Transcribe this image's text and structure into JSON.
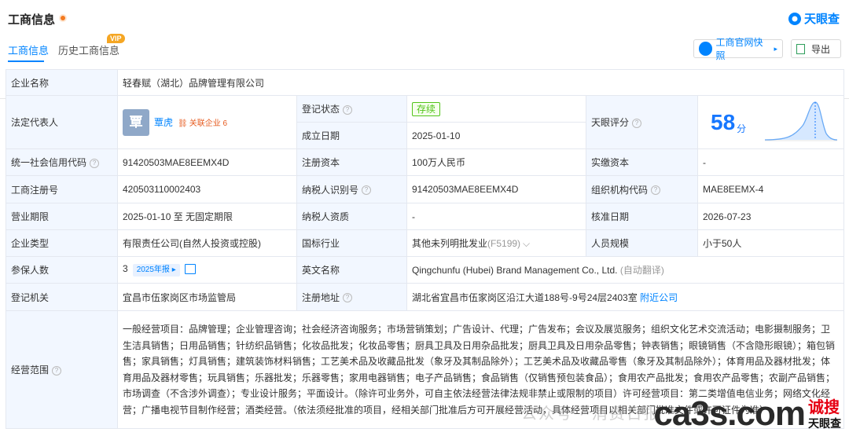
{
  "header": {
    "title": "工商信息",
    "logo_text": "天眼查"
  },
  "tabs": [
    {
      "label": "工商信息"
    },
    {
      "label": "历史工商信息"
    }
  ],
  "vip_label": "VIP",
  "buttons": {
    "snapshot": "工商官网快照",
    "export": "导出"
  },
  "fields": {
    "company_name_k": "企业名称",
    "company_name_v": "轻春赋（湖北）品牌管理有限公司",
    "legal_rep_k": "法定代表人",
    "legal_rep_avatar": "覃",
    "legal_rep_name": "覃虎",
    "legal_rep_related": "关联企业 6",
    "reg_status_k": "登记状态",
    "reg_status_v": "存续",
    "founded_k": "成立日期",
    "founded_v": "2025-01-10",
    "score_k": "天眼评分",
    "score_v": "58",
    "score_unit": "分",
    "credit_code_k": "统一社会信用代码",
    "credit_code_v": "91420503MAE8EEMX4D",
    "reg_capital_k": "注册资本",
    "reg_capital_v": "100万人民币",
    "paid_capital_k": "实缴资本",
    "paid_capital_v": "-",
    "reg_no_k": "工商注册号",
    "reg_no_v": "420503110002403",
    "taxpayer_id_k": "纳税人识别号",
    "taxpayer_id_v": "91420503MAE8EEMX4D",
    "org_code_k": "组织机构代码",
    "org_code_v": "MAE8EEMX-4",
    "term_k": "营业期限",
    "term_v": "2025-01-10 至 无固定期限",
    "taxpayer_qual_k": "纳税人资质",
    "taxpayer_qual_v": "-",
    "approve_k": "核准日期",
    "approve_v": "2026-07-23",
    "type_k": "企业类型",
    "type_v": "有限责任公司(自然人投资或控股)",
    "industry_k": "国标行业",
    "industry_v": "其他未列明批发业",
    "industry_code": "(F5199)",
    "staff_k": "人员规模",
    "staff_v": "小于50人",
    "insured_k": "参保人数",
    "insured_v": "3",
    "insured_year": "2025年报",
    "en_name_k": "英文名称",
    "en_name_v": "Qingchunfu (Hubei) Brand Management Co., Ltd.",
    "en_name_note": "(自动翻译)",
    "authority_k": "登记机关",
    "authority_v": "宜昌市伍家岗区市场监管局",
    "address_k": "注册地址",
    "address_v": "湖北省宜昌市伍家岗区沿江大道188号-9号24层2403室",
    "address_link": "附近公司",
    "scope_k": "经营范围",
    "scope_v": "一般经营项目：品牌管理；企业管理咨询；社会经济咨询服务；市场营销策划；广告设计、代理；广告发布；会议及展览服务；组织文化艺术交流活动；电影摄制服务；卫生洁具销售；日用品销售；针纺织品销售；化妆品批发；化妆品零售；厨具卫具及日用杂品批发；厨具卫具及日用杂品零售；钟表销售；眼镜销售（不含隐形眼镜）；箱包销售；家具销售；灯具销售；建筑装饰材料销售；工艺美术品及收藏品批发（象牙及其制品除外）；工艺美术品及收藏品零售（象牙及其制品除外）；体育用品及器材批发；体育用品及器材零售；玩具销售；乐器批发；乐器零售；家用电器销售；电子产品销售；食品销售（仅销售预包装食品）；食用农产品批发；食用农产品零售；农副产品销售；市场调查（不含涉外调查）；专业设计服务；平面设计。（除许可业务外，可自主依法经营法律法规非禁止或限制的项目）许可经营项目：第二类增值电信业务；网络文化经营；广播电视节目制作经营；酒类经营。（依法须经批准的项目，经相关部门批准后方可开展经营活动，具体经营项目以相关部门批准文件或许可证件为准）"
  },
  "watermark": {
    "faint": "公众号 · 消费日报",
    "big": "ca3s.com",
    "side_red": "诚搜",
    "side_black": "天眼查"
  },
  "colors": {
    "accent": "#0084ff",
    "key_bg": "#f2f7ff",
    "status_green": "#52c41a"
  }
}
